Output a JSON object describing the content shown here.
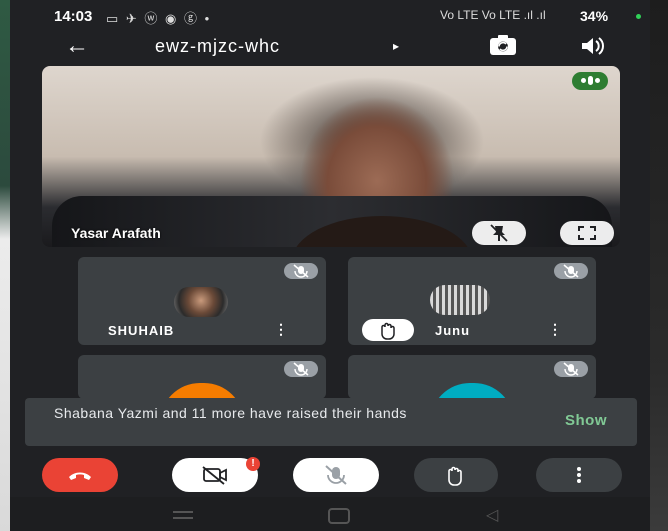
{
  "status_bar": {
    "time": "14:03",
    "left_icons": "▭ ✈ ⓦ ◉ ⓖ •",
    "network": "Vo LTE Vo LTE .ıl .ıl",
    "battery": "34%"
  },
  "header": {
    "back_icon": "arrow-back-icon",
    "meeting_code": "ewz-mjzc-whc",
    "caret": "▸",
    "switch_camera_icon": "camera-switch-icon",
    "speaker_icon": "volume-icon"
  },
  "main_tile": {
    "participant_name": "Yasar Arafath",
    "speaking_indicator_color": "#2e7d32",
    "pin_icon": "pin-icon",
    "fullscreen_icon": "fullscreen-icon"
  },
  "tiles": [
    {
      "name": "SHUHAIB",
      "muted": true,
      "hand_raised": false
    },
    {
      "name": "Junu",
      "muted": true,
      "hand_raised": true
    },
    {
      "name": "",
      "muted": true,
      "avatar_color": "#f57c00"
    },
    {
      "name": "",
      "muted": true,
      "avatar_color": "#00acc1"
    }
  ],
  "toast": {
    "message": "Shabana Yazmi and 11 more have raised their hands",
    "action": "Show"
  },
  "controls": {
    "end_call_color": "#ea4335",
    "camera_badge": "!",
    "buttons": [
      "end-call-icon",
      "camera-off-icon",
      "mic-off-icon",
      "raise-hand-icon",
      "more-vert-icon"
    ]
  },
  "colors": {
    "background": "#202124",
    "tile": "#3c4043",
    "accent_green": "#81c995"
  }
}
